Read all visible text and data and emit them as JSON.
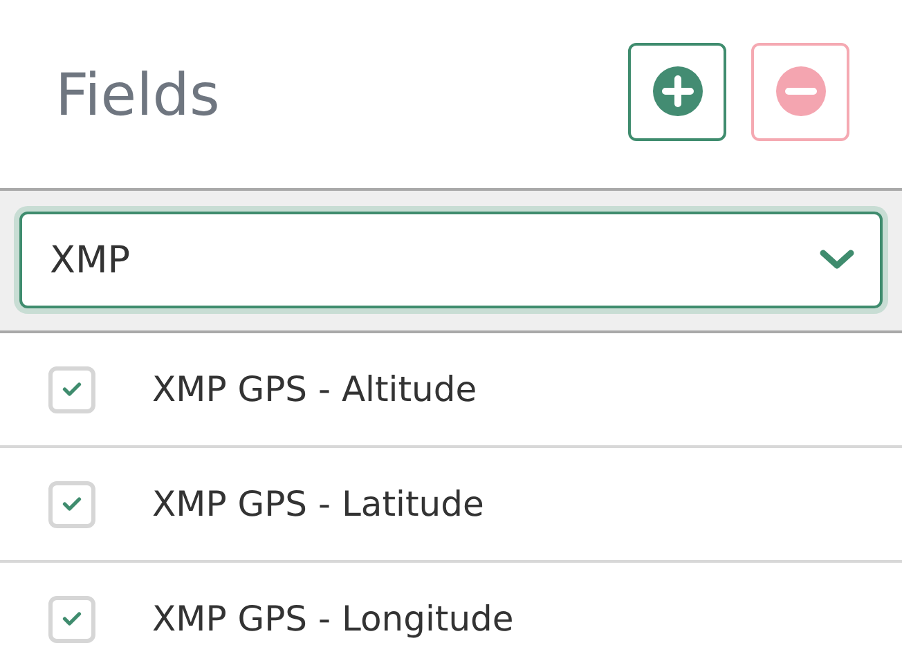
{
  "header": {
    "title": "Fields",
    "buttons": [
      {
        "kind": "add",
        "disabled": false
      },
      {
        "kind": "remove",
        "disabled": true
      }
    ]
  },
  "filter": {
    "value": "XMP"
  },
  "fields": [
    {
      "label": "XMP GPS - Altitude",
      "checked": true
    },
    {
      "label": "XMP GPS - Latitude",
      "checked": true
    },
    {
      "label": "XMP GPS - Longitude",
      "checked": true
    }
  ]
}
